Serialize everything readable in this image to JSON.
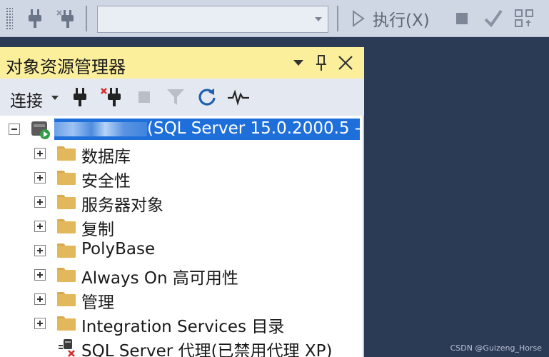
{
  "toolbar": {
    "execute_label": "执行(X)",
    "icons": [
      "grip-icon",
      "plug-icon",
      "debug-plug-icon",
      "play-icon",
      "stop-icon",
      "check-icon",
      "layout-icon"
    ]
  },
  "panel": {
    "title": "对象资源管理器",
    "connect_label": "连接",
    "buttons": [
      "dropdown-caret-icon",
      "pin-icon",
      "close-icon"
    ]
  },
  "tree": {
    "server": {
      "label_visible": "(SQL Server 15.0.2000.5 -",
      "label_redacted": true
    },
    "items": [
      {
        "label": "数据库"
      },
      {
        "label": "安全性"
      },
      {
        "label": "服务器对象"
      },
      {
        "label": "复制"
      },
      {
        "label": "PolyBase"
      },
      {
        "label": "Always On 高可用性"
      },
      {
        "label": "管理"
      },
      {
        "label": "Integration Services 目录"
      }
    ],
    "agent": {
      "label": "SQL Server 代理(已禁用代理 XP)"
    }
  },
  "colors": {
    "toolbar_bg": "#cfd6e4",
    "panel_title_bg": "#fbef9b",
    "selection": "#1e6fd9",
    "background": "#2b3a55",
    "folder": "#e3b75c"
  },
  "watermark": "CSDN @Guizeng_Horse"
}
